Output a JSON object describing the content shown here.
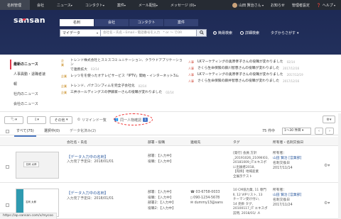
{
  "topbar": {
    "items": [
      "名刺管理",
      "会社",
      "ニュース",
      "コンタクト",
      "案件",
      "メール配信",
      "メッセージ (0)"
    ],
    "user": "山田 賢治さん",
    "notice": "お知らせ",
    "settings": "管理者設定",
    "help": "ヘルプ"
  },
  "header": {
    "logo_main": "sansan",
    "tabs": [
      "名刺",
      "会社",
      "コンタクト",
      "案件"
    ],
    "search_type": "マイデータ",
    "search_placeholder": "会社名・氏名・Email・電話番号を入力　* or ～ でOR",
    "opt_simple": "簡易検索",
    "opt_detail": "詳細検索",
    "opt_tags": "タグからさがす"
  },
  "news": {
    "nav": [
      "最新のニュース",
      "人事異動・退職者速報",
      "社内のニュース",
      "会社のニュース"
    ],
    "left": [
      {
        "tag": "企業",
        "text": "トレンド株式会社とスミスコミュニケーション、クラウドアプリケーション",
        "text2": "で連携拡大",
        "date": "02/14"
      },
      {
        "tag": "企業",
        "text": "レッツをを使ったオテレビサービス「IPTV」開始・インターネット3ム",
        "text2": "",
        "date": "02/14"
      },
      {
        "tag": "企業",
        "text": "トレンド、パナコンプィムを完全子会社化",
        "text2": "",
        "date": "02/14"
      },
      {
        "tag": "企業",
        "text": "三井ホールディングスの伊藤家一さんの役職が変わりました",
        "text2": "",
        "date": "02/14"
      }
    ],
    "right": [
      {
        "tag": "人事",
        "text": "LKマーケティングの奥原孝子さんの役職が変わりました",
        "date": "02/14"
      },
      {
        "tag": "人事",
        "text": "さくら生命保険の藤川智恵さんの役職が変わりました",
        "date": "2017/12/16"
      },
      {
        "tag": "人事",
        "text": "LKマーケティングの奥原孝子さんの役職が変わりました",
        "date": "2017/12/19"
      },
      {
        "tag": "人事",
        "text": "さくら生命保険の藤井智恵さんの役職が変わりました",
        "date": "2017/12/16"
      }
    ]
  },
  "toolbar": {
    "other": "その他",
    "remind": "リマインド一覧",
    "merge": "同一人物確認",
    "merge_count": "1"
  },
  "listtabs": {
    "all": "すべて(75)",
    "selected": "選択中(0)",
    "data_pending": "データ化済み(2)"
  },
  "pager": {
    "count": "75 件中",
    "range": "1〜30 件目"
  },
  "columns": [
    "会社名・氏名",
    "部署・役職",
    "連絡先",
    "タグ",
    "所有者・名刺交換日"
  ],
  "rows": [
    {
      "name": "【データ入力中の名刺】",
      "date": "入力完了予定日：2018/01/01",
      "dept": "部署：【入力中】",
      "title": "役職：【入力中】",
      "contact": "",
      "tags": [
        "[発行] 会員 方針",
        "_20191026_2109III03,",
        "20181009_ITエキスポ",
        "に出展者2018,",
        "【売掛】地域産業",
        "全展示テスト"
      ],
      "owner_label": "所有者：",
      "owner": "山田 賢治 [営業部]",
      "exch_label": "名刺交換日",
      "exch": "2017/11/14",
      "card_name": "名刺 太郎"
    },
    {
      "name": "【データ入力中の名刺】",
      "date": "入力完了予定日：2018/01/01",
      "dept": "部署：【入力中】",
      "title": "役職：【入力中】",
      "dept2": "部署2：【入力中】",
      "title2": "役職2：【入力中】",
      "phone": "03-6758-0033",
      "mobile": "090-1234-5678",
      "email": "dummy13@sans",
      "tags": [
        "10 CM協力業, 11 専門",
        "Ⅱ, 12 VIPリスト, 13",
        "チーマン受け付い,",
        "14 売掛 タグ,",
        "20100117_IT エキスポ",
        "訪問, 2018/01/ .A"
      ],
      "owner_label": "所有者：",
      "owner": "山田 賢治 [営業部]",
      "exch_label": "名刺交換日",
      "exch": "2017/11/24",
      "card_name": "名刺 太郎"
    }
  ],
  "status_url": "https://ap.sansan.com/v/mycoo"
}
